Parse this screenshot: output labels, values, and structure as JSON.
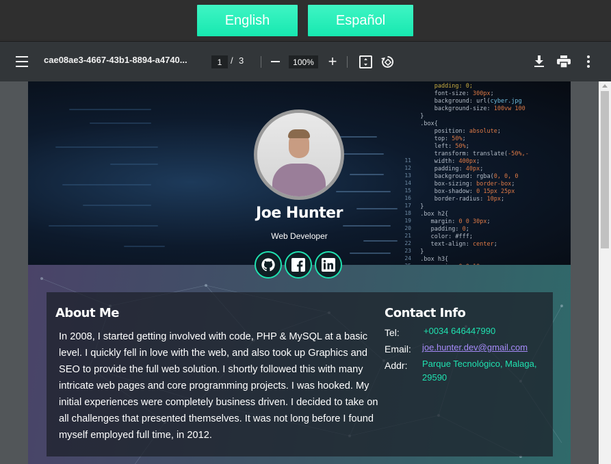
{
  "language_bar": {
    "english_label": "English",
    "spanish_label": "Español"
  },
  "pdf_toolbar": {
    "document_title": "cae08ae3-4667-43b1-8894-a4740...",
    "current_page": "1",
    "page_separator": "/",
    "total_pages": "3",
    "zoom_level": "100%",
    "zoom_in_label": "+"
  },
  "profile": {
    "name": "Joe Hunter",
    "role": "Web Developer"
  },
  "about": {
    "title": "About Me",
    "text": "In 2008, I started getting involved with code, PHP & MySQL at a basic level. I quickly fell in love with the web, and also took up Graphics and SEO to provide the full web solution. I shortly followed this with many intricate web pages and core programming projects. I was hooked. My initial experiences were completely business driven. I decided to take on all challenges that presented themselves. It was not long before I found myself employed full time, in 2012."
  },
  "contact": {
    "title": "Contact Info",
    "tel_label": "Tel:",
    "tel_value": "+0034 646447990",
    "email_label": "Email:",
    "email_value": "joe.hunter.dev@gmail.com",
    "addr_label": "Addr:",
    "addr_line1": "Parque Tecnológico, Malaga,",
    "addr_line2": "29590"
  },
  "colors": {
    "accent": "#1fe2b0",
    "link": "#a78bfa",
    "toolbar_bg": "#323639",
    "language_button": "#2ef0bd"
  },
  "icons": [
    "menu-icon",
    "fit-to-page-icon",
    "rotate-icon",
    "download-icon",
    "print-icon",
    "more-options-icon",
    "github-icon",
    "facebook-icon",
    "linkedin-icon"
  ]
}
